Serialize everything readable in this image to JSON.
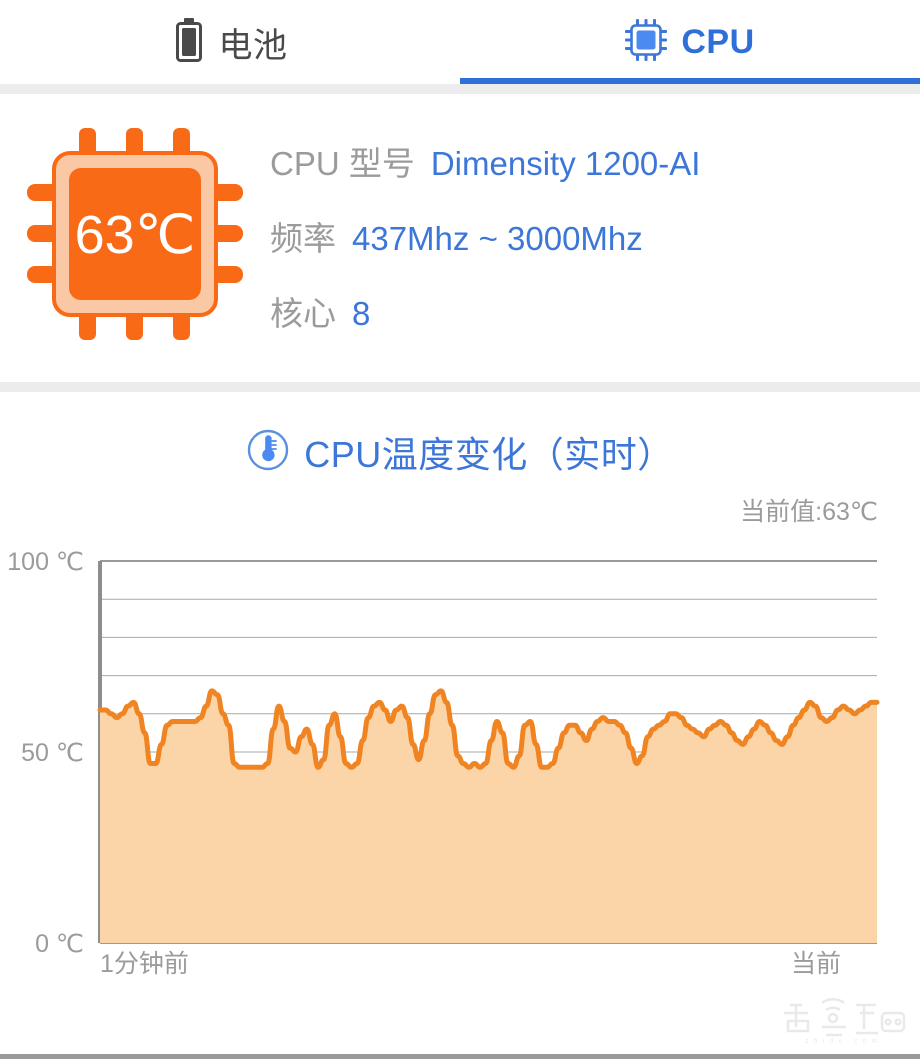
{
  "tabs": [
    {
      "id": "battery",
      "label": "电池",
      "icon": "battery-icon",
      "active": false
    },
    {
      "id": "cpu",
      "label": "CPU",
      "icon": "cpu-chip-icon",
      "active": true
    }
  ],
  "cpu_card": {
    "chip_icon": "cpu-chip-temperature-icon",
    "chip_temperature": "63℃",
    "rows": [
      {
        "key": "CPU 型号",
        "value": "Dimensity 1200-AI"
      },
      {
        "key": "频率",
        "value": "437Mhz ~ 3000Mhz"
      },
      {
        "key": "核心",
        "value": "8"
      }
    ]
  },
  "chart_section": {
    "icon": "thermometer-icon",
    "title": "CPU温度变化（实时）",
    "current_value_label": "当前值:63℃"
  },
  "colors": {
    "accent_blue": "#3b76d8",
    "tab_active_blue": "#2f6fd8",
    "orange_line": "#F08422",
    "orange_fill": "#FBD5A8",
    "chip_orange": "#F96A16",
    "chip_light": "#FBC8A5",
    "muted_gray": "#9b9b9b",
    "divider_gray": "#ececec"
  },
  "watermark": {
    "text": "智东西",
    "sub": "zhidx.com"
  },
  "chart_data": {
    "type": "area",
    "title": "CPU温度变化（实时）",
    "xlabel": "",
    "ylabel": "°C",
    "ylim": [
      0,
      100
    ],
    "yticks": [
      0,
      50,
      100
    ],
    "ytick_labels": [
      "0 ℃",
      "50 ℃",
      "100 ℃"
    ],
    "gridline_step": 10,
    "grid": true,
    "legend": false,
    "x_axis_labels": [
      "1分钟前",
      "当前"
    ],
    "series": [
      {
        "name": "CPU温度",
        "unit": "℃",
        "line_color": "#F08422",
        "fill_color": "#FBD5A8",
        "values": [
          61,
          61,
          60,
          59,
          60,
          62,
          63,
          60,
          55,
          47,
          47,
          52,
          57,
          58,
          58,
          58,
          58,
          58,
          59,
          62,
          66,
          65,
          60,
          57,
          47,
          46,
          46,
          46,
          46,
          46,
          47,
          56,
          62,
          58,
          51,
          50,
          54,
          56,
          52,
          46,
          48,
          57,
          60,
          54,
          47,
          46,
          47,
          53,
          59,
          62,
          63,
          61,
          58,
          61,
          62,
          59,
          52,
          48,
          53,
          60,
          65,
          66,
          63,
          57,
          49,
          47,
          46,
          47,
          46,
          47,
          53,
          58,
          55,
          47,
          46,
          49,
          57,
          58,
          52,
          46,
          46,
          47,
          51,
          55,
          57,
          57,
          55,
          53,
          56,
          58,
          59,
          58,
          58,
          57,
          55,
          51,
          47,
          49,
          54,
          56,
          57,
          58,
          60,
          60,
          59,
          57,
          56,
          55,
          54,
          56,
          57,
          58,
          57,
          55,
          53,
          52,
          54,
          56,
          58,
          57,
          55,
          53,
          52,
          54,
          57,
          59,
          61,
          63,
          62,
          59,
          58,
          59,
          61,
          62,
          61,
          60,
          61,
          62,
          63,
          63
        ]
      }
    ]
  }
}
